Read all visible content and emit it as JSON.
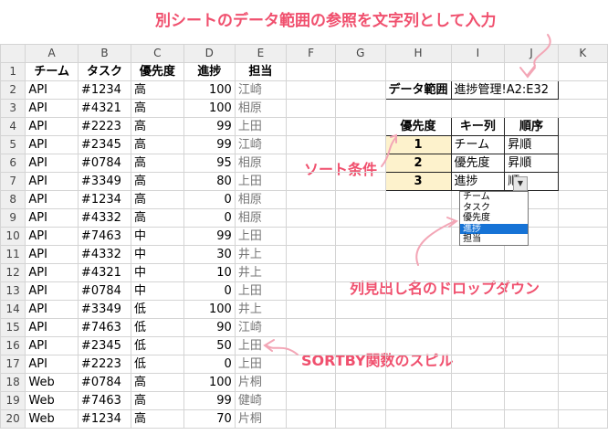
{
  "annotations": {
    "top": "別シートのデータ範囲の参照を文字列として入力",
    "sort_cond": "ソート条件",
    "dropdown_label": "列見出し名のドロップダウン",
    "spill": "SORTBY関数のスピル"
  },
  "columns": [
    "A",
    "B",
    "C",
    "D",
    "E",
    "F",
    "G",
    "H",
    "I",
    "J",
    "K"
  ],
  "headers": {
    "team": "チーム",
    "task": "タスク",
    "priority": "優先度",
    "progress": "進捗",
    "owner": "担当"
  },
  "rows": [
    {
      "n": "1"
    },
    {
      "n": "2",
      "team": "API",
      "task": "#1234",
      "pri": "高",
      "prog": "100",
      "owner": "江崎"
    },
    {
      "n": "3",
      "team": "API",
      "task": "#4321",
      "pri": "高",
      "prog": "100",
      "owner": "相原"
    },
    {
      "n": "4",
      "team": "API",
      "task": "#2223",
      "pri": "高",
      "prog": "99",
      "owner": "上田"
    },
    {
      "n": "5",
      "team": "API",
      "task": "#2345",
      "pri": "高",
      "prog": "99",
      "owner": "江崎"
    },
    {
      "n": "6",
      "team": "API",
      "task": "#0784",
      "pri": "高",
      "prog": "95",
      "owner": "相原"
    },
    {
      "n": "7",
      "team": "API",
      "task": "#3349",
      "pri": "高",
      "prog": "80",
      "owner": "上田"
    },
    {
      "n": "8",
      "team": "API",
      "task": "#1234",
      "pri": "高",
      "prog": "0",
      "owner": "相原"
    },
    {
      "n": "9",
      "team": "API",
      "task": "#4332",
      "pri": "高",
      "prog": "0",
      "owner": "相原"
    },
    {
      "n": "10",
      "team": "API",
      "task": "#7463",
      "pri": "中",
      "prog": "99",
      "owner": "上田"
    },
    {
      "n": "11",
      "team": "API",
      "task": "#4332",
      "pri": "中",
      "prog": "30",
      "owner": "井上"
    },
    {
      "n": "12",
      "team": "API",
      "task": "#4321",
      "pri": "中",
      "prog": "10",
      "owner": "井上"
    },
    {
      "n": "13",
      "team": "API",
      "task": "#0784",
      "pri": "中",
      "prog": "0",
      "owner": "上田"
    },
    {
      "n": "14",
      "team": "API",
      "task": "#3349",
      "pri": "低",
      "prog": "100",
      "owner": "井上"
    },
    {
      "n": "15",
      "team": "API",
      "task": "#7463",
      "pri": "低",
      "prog": "90",
      "owner": "江崎"
    },
    {
      "n": "16",
      "team": "API",
      "task": "#2345",
      "pri": "低",
      "prog": "50",
      "owner": "上田"
    },
    {
      "n": "17",
      "team": "API",
      "task": "#2223",
      "pri": "低",
      "prog": "0",
      "owner": "上田"
    },
    {
      "n": "18",
      "team": "Web",
      "task": "#0784",
      "pri": "高",
      "prog": "100",
      "owner": "片桐"
    },
    {
      "n": "19",
      "team": "Web",
      "task": "#7463",
      "pri": "高",
      "prog": "99",
      "owner": "健崎"
    },
    {
      "n": "20",
      "team": "Web",
      "task": "#1234",
      "pri": "高",
      "prog": "70",
      "owner": "片桐"
    }
  ],
  "data_range": {
    "label": "データ範囲",
    "value": "進捗管理!A2:E32"
  },
  "sort_table": {
    "headers": [
      "優先度",
      "キー列",
      "順序"
    ],
    "rows": [
      {
        "rank": "1",
        "key": "チーム",
        "order": "昇順"
      },
      {
        "rank": "2",
        "key": "優先度",
        "order": "昇順"
      },
      {
        "rank": "3",
        "key": "進捗",
        "order": "順"
      }
    ]
  },
  "dropdown": {
    "options": [
      "チーム",
      "タスク",
      "優先度",
      "進捗",
      "担当"
    ],
    "selected": "進捗"
  }
}
